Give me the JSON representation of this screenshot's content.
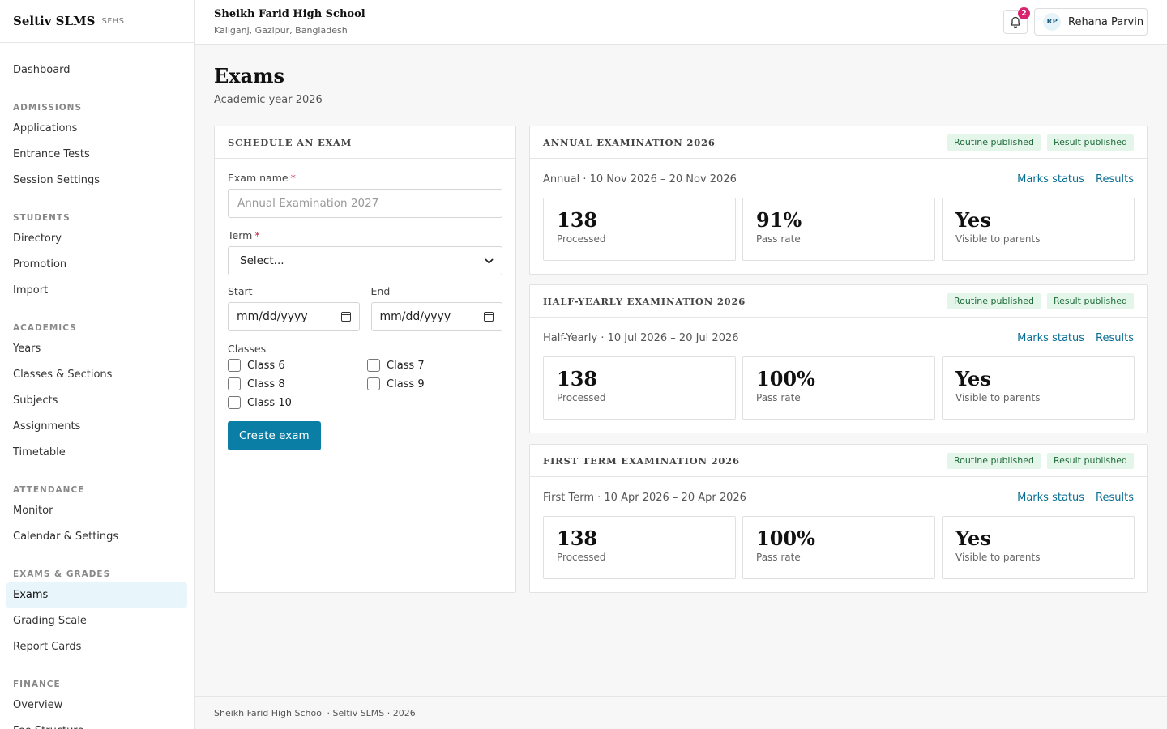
{
  "brand": {
    "name": "Seltiv SLMS",
    "code": "SFHS"
  },
  "sidebar": {
    "dashboard": "Dashboard",
    "sections": [
      {
        "title": "ADMISSIONS",
        "items": [
          "Applications",
          "Entrance Tests",
          "Session Settings"
        ]
      },
      {
        "title": "STUDENTS",
        "items": [
          "Directory",
          "Promotion",
          "Import"
        ]
      },
      {
        "title": "ACADEMICS",
        "items": [
          "Years",
          "Classes & Sections",
          "Subjects",
          "Assignments",
          "Timetable"
        ]
      },
      {
        "title": "ATTENDANCE",
        "items": [
          "Monitor",
          "Calendar & Settings"
        ]
      },
      {
        "title": "EXAMS & GRADES",
        "items": [
          "Exams",
          "Grading Scale",
          "Report Cards"
        ]
      },
      {
        "title": "FINANCE",
        "items": [
          "Overview",
          "Fee Structure"
        ]
      }
    ],
    "active": "Exams"
  },
  "header": {
    "school_name": "Sheikh Farid High School",
    "school_location": "Kaliganj, Gazipur, Bangladesh",
    "notification_count": "2",
    "user_initials": "RP",
    "user_name": "Rehana Parvin"
  },
  "page": {
    "title": "Exams",
    "subtitle": "Academic year 2026"
  },
  "form": {
    "title": "SCHEDULE AN EXAM",
    "exam_name_label": "Exam name",
    "exam_name_placeholder": "Annual Examination 2027",
    "term_label": "Term",
    "term_value": "Select...",
    "start_label": "Start",
    "start_value": "mm/dd/yyyy",
    "end_label": "End",
    "end_value": "mm/dd/yyyy",
    "classes_label": "Classes",
    "required_mark": "*",
    "classes": [
      "Class 6",
      "Class 7",
      "Class 8",
      "Class 9",
      "Class 10"
    ],
    "submit_label": "Create exam"
  },
  "exams": [
    {
      "title": "ANNUAL EXAMINATION 2026",
      "badges": [
        "Routine published",
        "Result published"
      ],
      "meta": "Annual · 10 Nov 2026 – 20 Nov 2026",
      "links": [
        "Marks status",
        "Results"
      ],
      "stats": [
        {
          "value": "138",
          "label": "Processed"
        },
        {
          "value": "91%",
          "label": "Pass rate"
        },
        {
          "value": "Yes",
          "label": "Visible to parents"
        }
      ]
    },
    {
      "title": "HALF-YEARLY EXAMINATION 2026",
      "badges": [
        "Routine published",
        "Result published"
      ],
      "meta": "Half-Yearly · 10 Jul 2026 – 20 Jul 2026",
      "links": [
        "Marks status",
        "Results"
      ],
      "stats": [
        {
          "value": "138",
          "label": "Processed"
        },
        {
          "value": "100%",
          "label": "Pass rate"
        },
        {
          "value": "Yes",
          "label": "Visible to parents"
        }
      ]
    },
    {
      "title": "FIRST TERM EXAMINATION 2026",
      "badges": [
        "Routine published",
        "Result published"
      ],
      "meta": "First Term · 10 Apr 2026 – 20 Apr 2026",
      "links": [
        "Marks status",
        "Results"
      ],
      "stats": [
        {
          "value": "138",
          "label": "Processed"
        },
        {
          "value": "100%",
          "label": "Pass rate"
        },
        {
          "value": "Yes",
          "label": "Visible to parents"
        }
      ]
    }
  ],
  "footer": {
    "text": "Sheikh Farid High School · Seltiv SLMS · 2026"
  },
  "colors": {
    "accent": "#0a7ea4",
    "badge_bg": "#e4f5ea",
    "badge_text": "#1e6b3a",
    "notification": "#d6246e"
  }
}
